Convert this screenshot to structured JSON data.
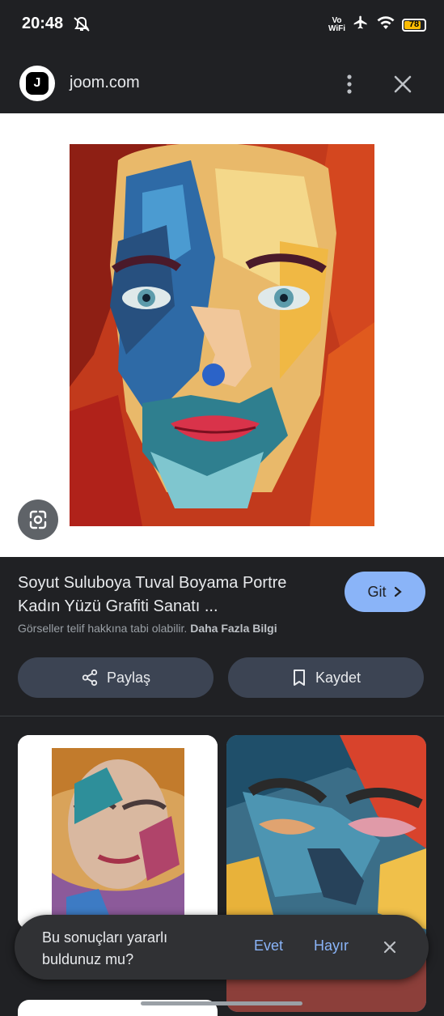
{
  "status": {
    "time": "20:48",
    "vowifi_top": "Vo",
    "vowifi_bottom": "WiFi",
    "battery": "78"
  },
  "toolbar": {
    "logo_letter": "J",
    "domain": "joom.com"
  },
  "result": {
    "title": "Soyut Suluboya Tuval Boyama Portre Kadın Yüzü Grafiti Sanatı ...",
    "visit_label": "Git",
    "copyright_text": "Görseller telif hakkına tabi olabilir.",
    "learn_more": "Daha Fazla Bilgi",
    "share_label": "Paylaş",
    "save_label": "Kaydet"
  },
  "feedback": {
    "question": "Bu sonuçları yararlı buldunuz mu?",
    "yes": "Evet",
    "no": "Hayır"
  },
  "colors": {
    "background": "#202124",
    "accent": "#8ab4f8",
    "button": "#3c4453"
  }
}
